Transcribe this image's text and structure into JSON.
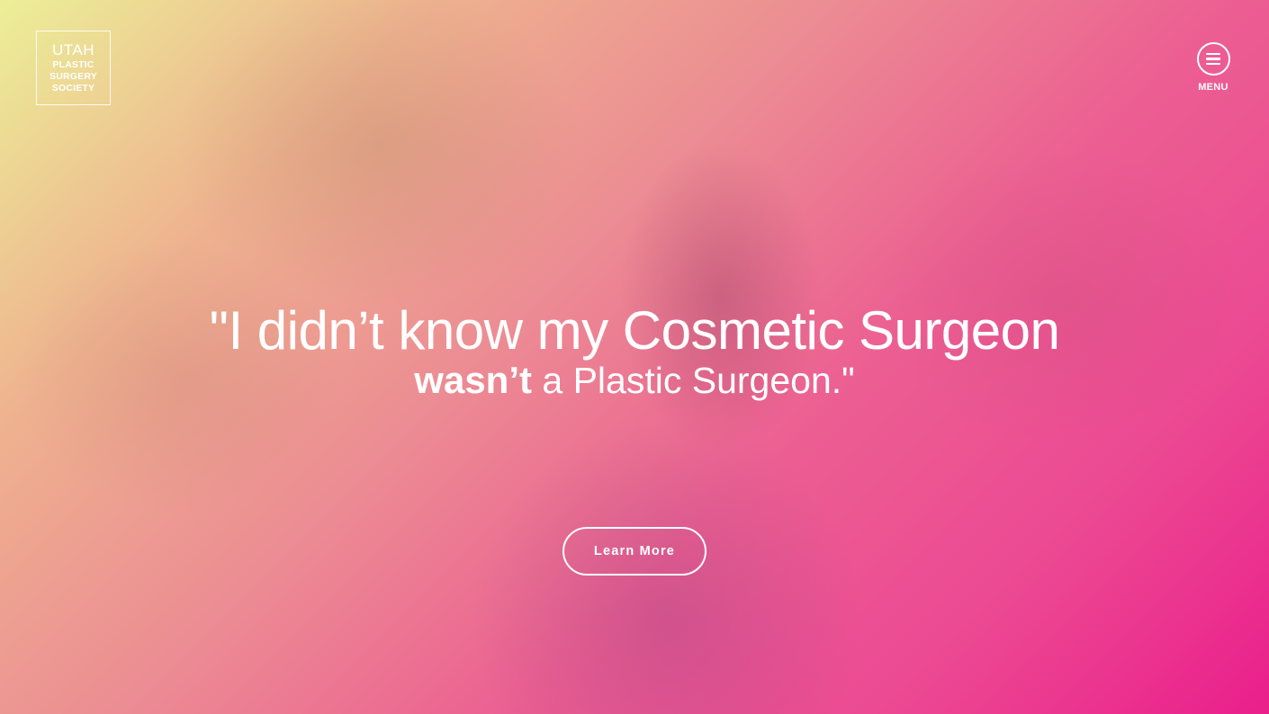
{
  "brand": {
    "logo_line1": "UTAH",
    "logo_line2": "PLASTIC",
    "logo_line3": "SURGERY",
    "logo_line4": "SOCIETY"
  },
  "nav": {
    "menu_label": "MENU",
    "menu_icon": "hamburger-icon"
  },
  "hero": {
    "quote_line1": "\"I didn’t know my Cosmetic Surgeon",
    "quote_emphasis": "wasn’t",
    "quote_line2_rest": " a Plastic Surgeon.\"",
    "cta_label": "Learn More"
  },
  "colors": {
    "gradient_start": "#ecef97",
    "gradient_mid": "#ec8c93",
    "gradient_end": "#ea1f8b",
    "text": "#ffffff"
  }
}
